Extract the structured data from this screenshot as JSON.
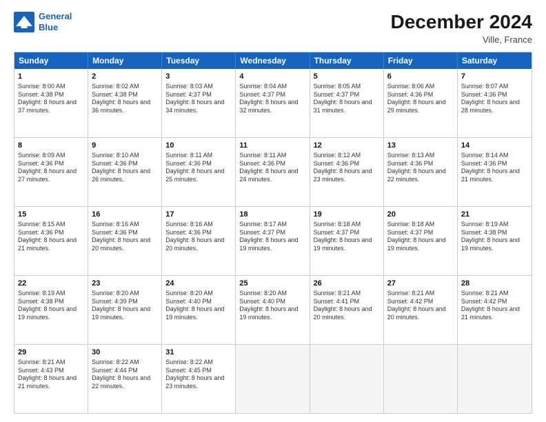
{
  "header": {
    "logo_line1": "General",
    "logo_line2": "Blue",
    "month": "December 2024",
    "location": "Ville, France"
  },
  "weekdays": [
    "Sunday",
    "Monday",
    "Tuesday",
    "Wednesday",
    "Thursday",
    "Friday",
    "Saturday"
  ],
  "weeks": [
    [
      {
        "day": "1",
        "sunrise": "Sunrise: 8:00 AM",
        "sunset": "Sunset: 4:38 PM",
        "daylight": "Daylight: 8 hours and 37 minutes."
      },
      {
        "day": "2",
        "sunrise": "Sunrise: 8:02 AM",
        "sunset": "Sunset: 4:38 PM",
        "daylight": "Daylight: 8 hours and 36 minutes."
      },
      {
        "day": "3",
        "sunrise": "Sunrise: 8:03 AM",
        "sunset": "Sunset: 4:37 PM",
        "daylight": "Daylight: 8 hours and 34 minutes."
      },
      {
        "day": "4",
        "sunrise": "Sunrise: 8:04 AM",
        "sunset": "Sunset: 4:37 PM",
        "daylight": "Daylight: 8 hours and 32 minutes."
      },
      {
        "day": "5",
        "sunrise": "Sunrise: 8:05 AM",
        "sunset": "Sunset: 4:37 PM",
        "daylight": "Daylight: 8 hours and 31 minutes."
      },
      {
        "day": "6",
        "sunrise": "Sunrise: 8:06 AM",
        "sunset": "Sunset: 4:36 PM",
        "daylight": "Daylight: 8 hours and 29 minutes."
      },
      {
        "day": "7",
        "sunrise": "Sunrise: 8:07 AM",
        "sunset": "Sunset: 4:36 PM",
        "daylight": "Daylight: 8 hours and 28 minutes."
      }
    ],
    [
      {
        "day": "8",
        "sunrise": "Sunrise: 8:09 AM",
        "sunset": "Sunset: 4:36 PM",
        "daylight": "Daylight: 8 hours and 27 minutes."
      },
      {
        "day": "9",
        "sunrise": "Sunrise: 8:10 AM",
        "sunset": "Sunset: 4:36 PM",
        "daylight": "Daylight: 8 hours and 26 minutes."
      },
      {
        "day": "10",
        "sunrise": "Sunrise: 8:11 AM",
        "sunset": "Sunset: 4:36 PM",
        "daylight": "Daylight: 8 hours and 25 minutes."
      },
      {
        "day": "11",
        "sunrise": "Sunrise: 8:11 AM",
        "sunset": "Sunset: 4:36 PM",
        "daylight": "Daylight: 8 hours and 24 minutes."
      },
      {
        "day": "12",
        "sunrise": "Sunrise: 8:12 AM",
        "sunset": "Sunset: 4:36 PM",
        "daylight": "Daylight: 8 hours and 23 minutes."
      },
      {
        "day": "13",
        "sunrise": "Sunrise: 8:13 AM",
        "sunset": "Sunset: 4:36 PM",
        "daylight": "Daylight: 8 hours and 22 minutes."
      },
      {
        "day": "14",
        "sunrise": "Sunrise: 8:14 AM",
        "sunset": "Sunset: 4:36 PM",
        "daylight": "Daylight: 8 hours and 21 minutes."
      }
    ],
    [
      {
        "day": "15",
        "sunrise": "Sunrise: 8:15 AM",
        "sunset": "Sunset: 4:36 PM",
        "daylight": "Daylight: 8 hours and 21 minutes."
      },
      {
        "day": "16",
        "sunrise": "Sunrise: 8:16 AM",
        "sunset": "Sunset: 4:36 PM",
        "daylight": "Daylight: 8 hours and 20 minutes."
      },
      {
        "day": "17",
        "sunrise": "Sunrise: 8:16 AM",
        "sunset": "Sunset: 4:36 PM",
        "daylight": "Daylight: 8 hours and 20 minutes."
      },
      {
        "day": "18",
        "sunrise": "Sunrise: 8:17 AM",
        "sunset": "Sunset: 4:37 PM",
        "daylight": "Daylight: 8 hours and 19 minutes."
      },
      {
        "day": "19",
        "sunrise": "Sunrise: 8:18 AM",
        "sunset": "Sunset: 4:37 PM",
        "daylight": "Daylight: 8 hours and 19 minutes."
      },
      {
        "day": "20",
        "sunrise": "Sunrise: 8:18 AM",
        "sunset": "Sunset: 4:37 PM",
        "daylight": "Daylight: 8 hours and 19 minutes."
      },
      {
        "day": "21",
        "sunrise": "Sunrise: 8:19 AM",
        "sunset": "Sunset: 4:38 PM",
        "daylight": "Daylight: 8 hours and 19 minutes."
      }
    ],
    [
      {
        "day": "22",
        "sunrise": "Sunrise: 8:19 AM",
        "sunset": "Sunset: 4:38 PM",
        "daylight": "Daylight: 8 hours and 19 minutes."
      },
      {
        "day": "23",
        "sunrise": "Sunrise: 8:20 AM",
        "sunset": "Sunset: 4:39 PM",
        "daylight": "Daylight: 8 hours and 19 minutes."
      },
      {
        "day": "24",
        "sunrise": "Sunrise: 8:20 AM",
        "sunset": "Sunset: 4:40 PM",
        "daylight": "Daylight: 8 hours and 19 minutes."
      },
      {
        "day": "25",
        "sunrise": "Sunrise: 8:20 AM",
        "sunset": "Sunset: 4:40 PM",
        "daylight": "Daylight: 8 hours and 19 minutes."
      },
      {
        "day": "26",
        "sunrise": "Sunrise: 8:21 AM",
        "sunset": "Sunset: 4:41 PM",
        "daylight": "Daylight: 8 hours and 20 minutes."
      },
      {
        "day": "27",
        "sunrise": "Sunrise: 8:21 AM",
        "sunset": "Sunset: 4:42 PM",
        "daylight": "Daylight: 8 hours and 20 minutes."
      },
      {
        "day": "28",
        "sunrise": "Sunrise: 8:21 AM",
        "sunset": "Sunset: 4:42 PM",
        "daylight": "Daylight: 8 hours and 21 minutes."
      }
    ],
    [
      {
        "day": "29",
        "sunrise": "Sunrise: 8:21 AM",
        "sunset": "Sunset: 4:43 PM",
        "daylight": "Daylight: 8 hours and 21 minutes."
      },
      {
        "day": "30",
        "sunrise": "Sunrise: 8:22 AM",
        "sunset": "Sunset: 4:44 PM",
        "daylight": "Daylight: 8 hours and 22 minutes."
      },
      {
        "day": "31",
        "sunrise": "Sunrise: 8:22 AM",
        "sunset": "Sunset: 4:45 PM",
        "daylight": "Daylight: 8 hours and 23 minutes."
      },
      null,
      null,
      null,
      null
    ]
  ]
}
